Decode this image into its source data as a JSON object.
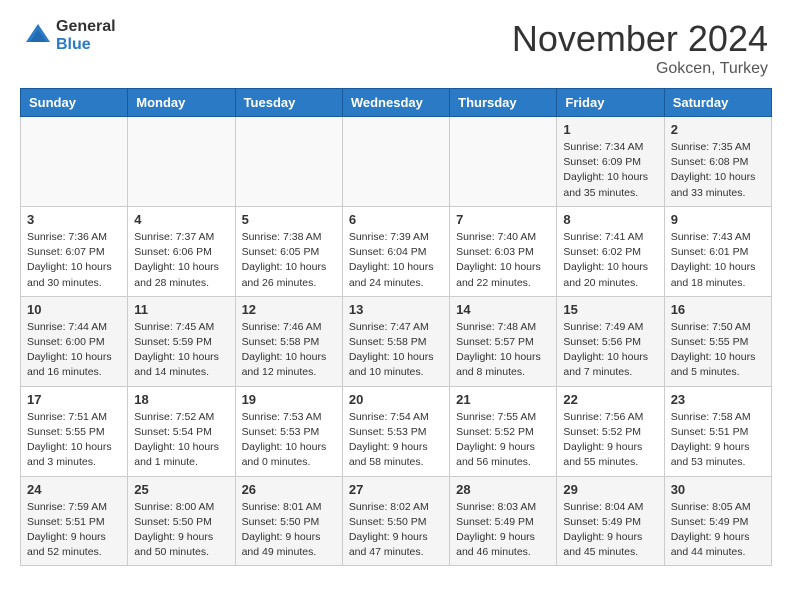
{
  "header": {
    "logo_general": "General",
    "logo_blue": "Blue",
    "month_title": "November 2024",
    "location": "Gokcen, Turkey"
  },
  "weekdays": [
    "Sunday",
    "Monday",
    "Tuesday",
    "Wednesday",
    "Thursday",
    "Friday",
    "Saturday"
  ],
  "weeks": [
    [
      {
        "day": "",
        "info": ""
      },
      {
        "day": "",
        "info": ""
      },
      {
        "day": "",
        "info": ""
      },
      {
        "day": "",
        "info": ""
      },
      {
        "day": "",
        "info": ""
      },
      {
        "day": "1",
        "info": "Sunrise: 7:34 AM\nSunset: 6:09 PM\nDaylight: 10 hours and 35 minutes."
      },
      {
        "day": "2",
        "info": "Sunrise: 7:35 AM\nSunset: 6:08 PM\nDaylight: 10 hours and 33 minutes."
      }
    ],
    [
      {
        "day": "3",
        "info": "Sunrise: 7:36 AM\nSunset: 6:07 PM\nDaylight: 10 hours and 30 minutes."
      },
      {
        "day": "4",
        "info": "Sunrise: 7:37 AM\nSunset: 6:06 PM\nDaylight: 10 hours and 28 minutes."
      },
      {
        "day": "5",
        "info": "Sunrise: 7:38 AM\nSunset: 6:05 PM\nDaylight: 10 hours and 26 minutes."
      },
      {
        "day": "6",
        "info": "Sunrise: 7:39 AM\nSunset: 6:04 PM\nDaylight: 10 hours and 24 minutes."
      },
      {
        "day": "7",
        "info": "Sunrise: 7:40 AM\nSunset: 6:03 PM\nDaylight: 10 hours and 22 minutes."
      },
      {
        "day": "8",
        "info": "Sunrise: 7:41 AM\nSunset: 6:02 PM\nDaylight: 10 hours and 20 minutes."
      },
      {
        "day": "9",
        "info": "Sunrise: 7:43 AM\nSunset: 6:01 PM\nDaylight: 10 hours and 18 minutes."
      }
    ],
    [
      {
        "day": "10",
        "info": "Sunrise: 7:44 AM\nSunset: 6:00 PM\nDaylight: 10 hours and 16 minutes."
      },
      {
        "day": "11",
        "info": "Sunrise: 7:45 AM\nSunset: 5:59 PM\nDaylight: 10 hours and 14 minutes."
      },
      {
        "day": "12",
        "info": "Sunrise: 7:46 AM\nSunset: 5:58 PM\nDaylight: 10 hours and 12 minutes."
      },
      {
        "day": "13",
        "info": "Sunrise: 7:47 AM\nSunset: 5:58 PM\nDaylight: 10 hours and 10 minutes."
      },
      {
        "day": "14",
        "info": "Sunrise: 7:48 AM\nSunset: 5:57 PM\nDaylight: 10 hours and 8 minutes."
      },
      {
        "day": "15",
        "info": "Sunrise: 7:49 AM\nSunset: 5:56 PM\nDaylight: 10 hours and 7 minutes."
      },
      {
        "day": "16",
        "info": "Sunrise: 7:50 AM\nSunset: 5:55 PM\nDaylight: 10 hours and 5 minutes."
      }
    ],
    [
      {
        "day": "17",
        "info": "Sunrise: 7:51 AM\nSunset: 5:55 PM\nDaylight: 10 hours and 3 minutes."
      },
      {
        "day": "18",
        "info": "Sunrise: 7:52 AM\nSunset: 5:54 PM\nDaylight: 10 hours and 1 minute."
      },
      {
        "day": "19",
        "info": "Sunrise: 7:53 AM\nSunset: 5:53 PM\nDaylight: 10 hours and 0 minutes."
      },
      {
        "day": "20",
        "info": "Sunrise: 7:54 AM\nSunset: 5:53 PM\nDaylight: 9 hours and 58 minutes."
      },
      {
        "day": "21",
        "info": "Sunrise: 7:55 AM\nSunset: 5:52 PM\nDaylight: 9 hours and 56 minutes."
      },
      {
        "day": "22",
        "info": "Sunrise: 7:56 AM\nSunset: 5:52 PM\nDaylight: 9 hours and 55 minutes."
      },
      {
        "day": "23",
        "info": "Sunrise: 7:58 AM\nSunset: 5:51 PM\nDaylight: 9 hours and 53 minutes."
      }
    ],
    [
      {
        "day": "24",
        "info": "Sunrise: 7:59 AM\nSunset: 5:51 PM\nDaylight: 9 hours and 52 minutes."
      },
      {
        "day": "25",
        "info": "Sunrise: 8:00 AM\nSunset: 5:50 PM\nDaylight: 9 hours and 50 minutes."
      },
      {
        "day": "26",
        "info": "Sunrise: 8:01 AM\nSunset: 5:50 PM\nDaylight: 9 hours and 49 minutes."
      },
      {
        "day": "27",
        "info": "Sunrise: 8:02 AM\nSunset: 5:50 PM\nDaylight: 9 hours and 47 minutes."
      },
      {
        "day": "28",
        "info": "Sunrise: 8:03 AM\nSunset: 5:49 PM\nDaylight: 9 hours and 46 minutes."
      },
      {
        "day": "29",
        "info": "Sunrise: 8:04 AM\nSunset: 5:49 PM\nDaylight: 9 hours and 45 minutes."
      },
      {
        "day": "30",
        "info": "Sunrise: 8:05 AM\nSunset: 5:49 PM\nDaylight: 9 hours and 44 minutes."
      }
    ]
  ]
}
